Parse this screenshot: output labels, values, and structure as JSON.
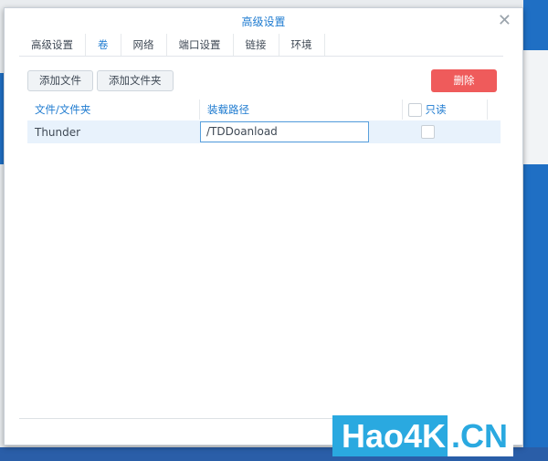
{
  "dialog": {
    "title": "高级设置",
    "close_icon": "close-icon"
  },
  "tabs": [
    {
      "label": "高级设置"
    },
    {
      "label": "卷",
      "active": true
    },
    {
      "label": "网络"
    },
    {
      "label": "端口设置"
    },
    {
      "label": "链接"
    },
    {
      "label": "环境"
    }
  ],
  "toolbar": {
    "add_file": "添加文件",
    "add_folder": "添加文件夹",
    "delete": "删除"
  },
  "table": {
    "headers": [
      "文件/文件夹",
      "装载路径",
      "只读"
    ],
    "rows": [
      {
        "name": "Thunder",
        "mount_path": "/TDDoanload",
        "readonly": false
      }
    ]
  },
  "watermark": {
    "part1": "Hao4K",
    "part2": ".CN"
  },
  "colors": {
    "accent": "#1e7bd0",
    "danger": "#ef5b5b"
  }
}
